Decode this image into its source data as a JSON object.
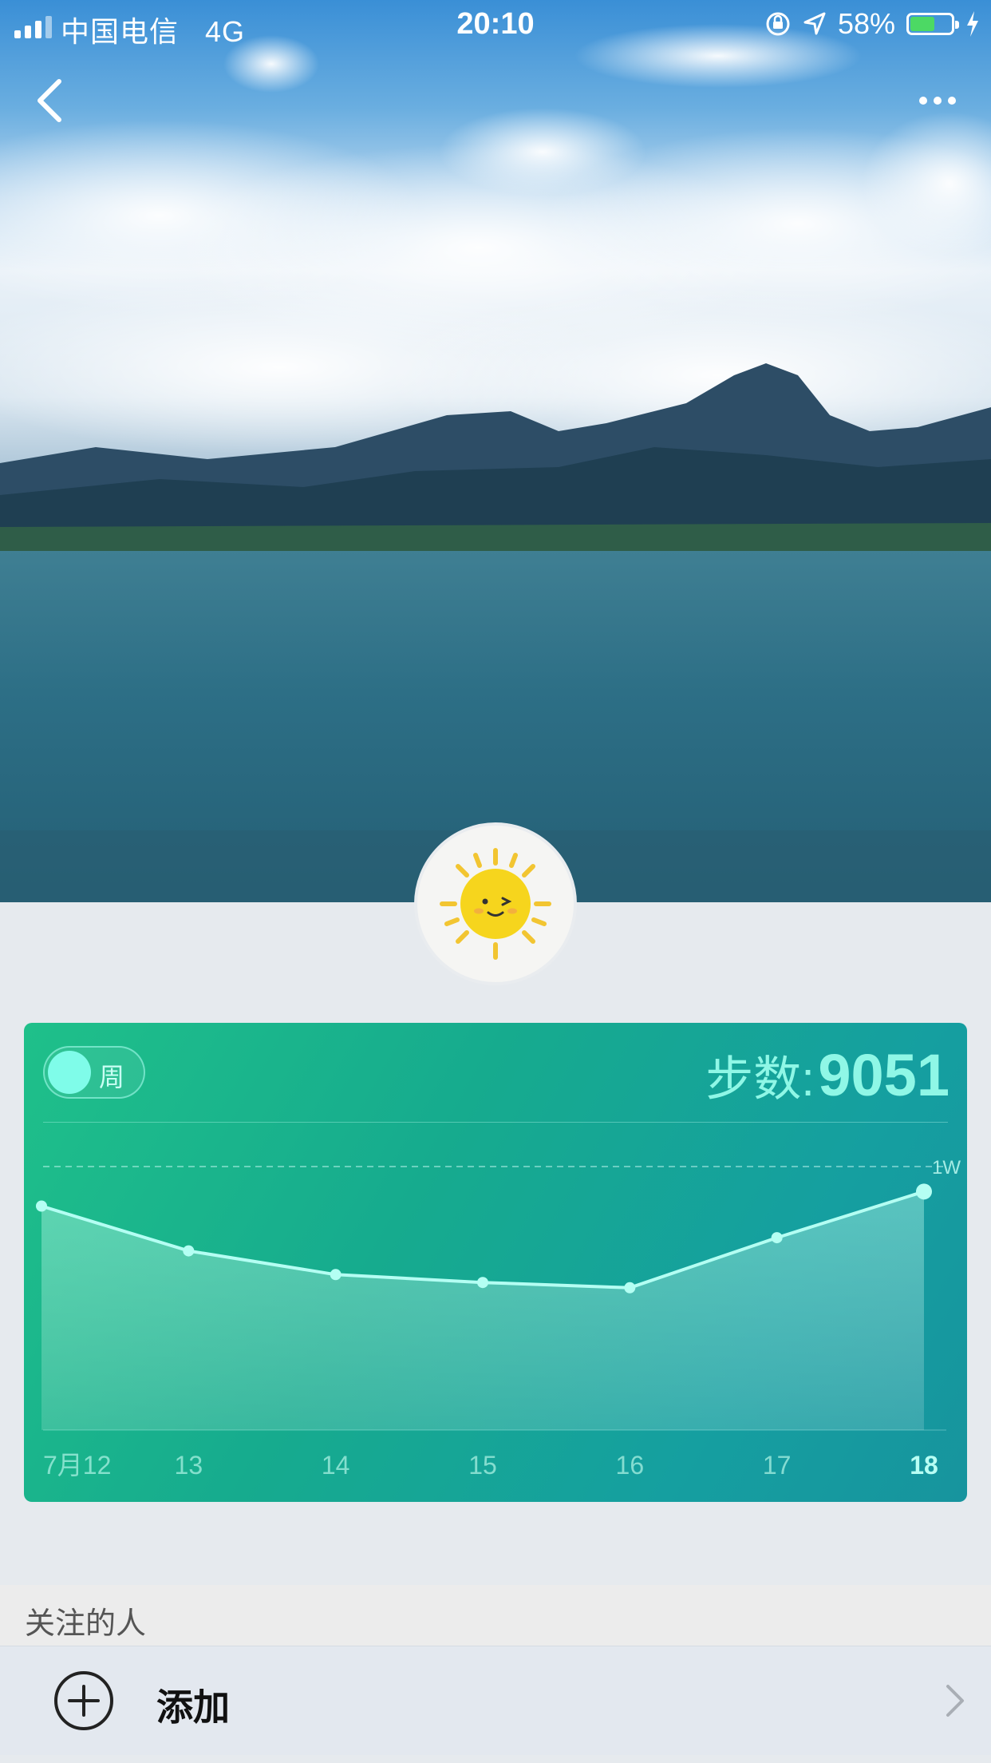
{
  "status_bar": {
    "carrier": "中国电信",
    "network": "4G",
    "time": "20:10",
    "battery_percent": "58%",
    "battery_level": 0.58,
    "icons": [
      "orientation-lock-icon",
      "location-icon",
      "battery-icon",
      "charging-icon"
    ]
  },
  "nav": {
    "back_icon": "chevron-left-icon",
    "more_icon": "ellipsis-icon"
  },
  "avatar": {
    "icon": "smiling-sun-icon"
  },
  "step_card": {
    "toggle_label": "周",
    "steps_label": "步数:",
    "steps_value": "9051"
  },
  "chart_data": {
    "type": "area",
    "title": "",
    "xlabel": "",
    "ylabel": "",
    "categories": [
      "7月12",
      "13",
      "14",
      "15",
      "16",
      "17",
      "18"
    ],
    "values": [
      8500,
      6800,
      5900,
      5600,
      5400,
      7300,
      9051
    ],
    "reference_line": {
      "value": 10000,
      "label": "1W"
    },
    "ylim": [
      0,
      10000
    ],
    "highlight_index": 6,
    "grid": false,
    "legend": "none"
  },
  "following": {
    "section_title": "关注的人",
    "add_label": "添加",
    "add_icon": "plus-circle-icon",
    "chevron_icon": "chevron-right-icon"
  },
  "colors": {
    "card_start": "#1fc08a",
    "card_end": "#17949e",
    "accent_text": "#8ff7e6",
    "line": "#b4fff3",
    "battery_fill": "#4cd964"
  }
}
